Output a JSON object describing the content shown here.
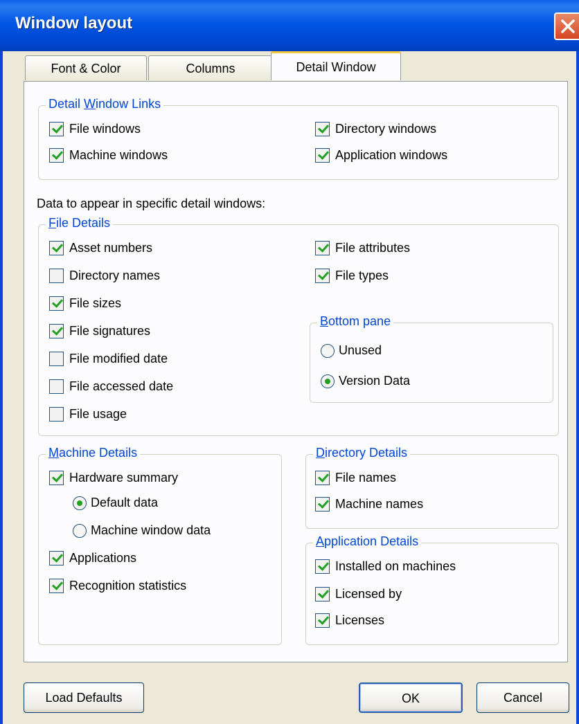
{
  "window": {
    "title": "Window layout"
  },
  "tabs": [
    {
      "label": "Font & Color",
      "active": false
    },
    {
      "label": "Columns",
      "active": false
    },
    {
      "label": "Detail Window",
      "active": true
    }
  ],
  "links_group": {
    "legend_pre": "Detail ",
    "legend_u": "W",
    "legend_post": "indow Links",
    "items": [
      {
        "label": "File windows",
        "checked": true
      },
      {
        "label": "Directory windows",
        "checked": true
      },
      {
        "label": "Machine windows",
        "checked": true
      },
      {
        "label": "Application windows",
        "checked": true
      }
    ]
  },
  "data_label": "Data to appear in specific detail windows:",
  "file_group": {
    "legend_u": "F",
    "legend_post": "ile Details",
    "left_items": [
      {
        "label": "Asset numbers",
        "checked": true
      },
      {
        "label": "Directory names",
        "checked": false
      },
      {
        "label": "File sizes",
        "checked": true
      },
      {
        "label": "File signatures",
        "checked": true
      },
      {
        "label": "File modified date",
        "checked": false
      },
      {
        "label": "File accessed date",
        "checked": false
      },
      {
        "label": "File usage",
        "checked": false
      }
    ],
    "right_items": [
      {
        "label": "File attributes",
        "checked": true
      },
      {
        "label": "File types",
        "checked": true
      }
    ]
  },
  "bottom_pane": {
    "legend_u": "B",
    "legend_post": "ottom pane",
    "options": [
      {
        "label": "Unused",
        "selected": false
      },
      {
        "label": "Version Data",
        "selected": true
      }
    ]
  },
  "machine_group": {
    "legend_u": "M",
    "legend_post": "achine Details",
    "hardware": {
      "label": "Hardware summary",
      "checked": true
    },
    "radios": [
      {
        "label": "Default data",
        "selected": true
      },
      {
        "label": "Machine window data",
        "selected": false
      }
    ],
    "items": [
      {
        "label": "Applications",
        "checked": true
      },
      {
        "label": "Recognition statistics",
        "checked": true
      }
    ]
  },
  "directory_group": {
    "legend_u": "D",
    "legend_post": "irectory Details",
    "items": [
      {
        "label": "File names",
        "checked": true
      },
      {
        "label": "Machine names",
        "checked": true
      }
    ]
  },
  "application_group": {
    "legend_u": "A",
    "legend_post": "pplication Details",
    "items": [
      {
        "label": "Installed on machines",
        "checked": true
      },
      {
        "label": "Licensed by",
        "checked": true
      },
      {
        "label": "Licenses",
        "checked": true
      }
    ]
  },
  "buttons": {
    "load_defaults": "Load Defaults",
    "ok": "OK",
    "cancel": "Cancel"
  },
  "colors": {
    "titlebar": "#0055e5",
    "legend_text": "#0046d5",
    "check_mark": "#21a121",
    "active_tab_highlight": "#ffc83c"
  }
}
